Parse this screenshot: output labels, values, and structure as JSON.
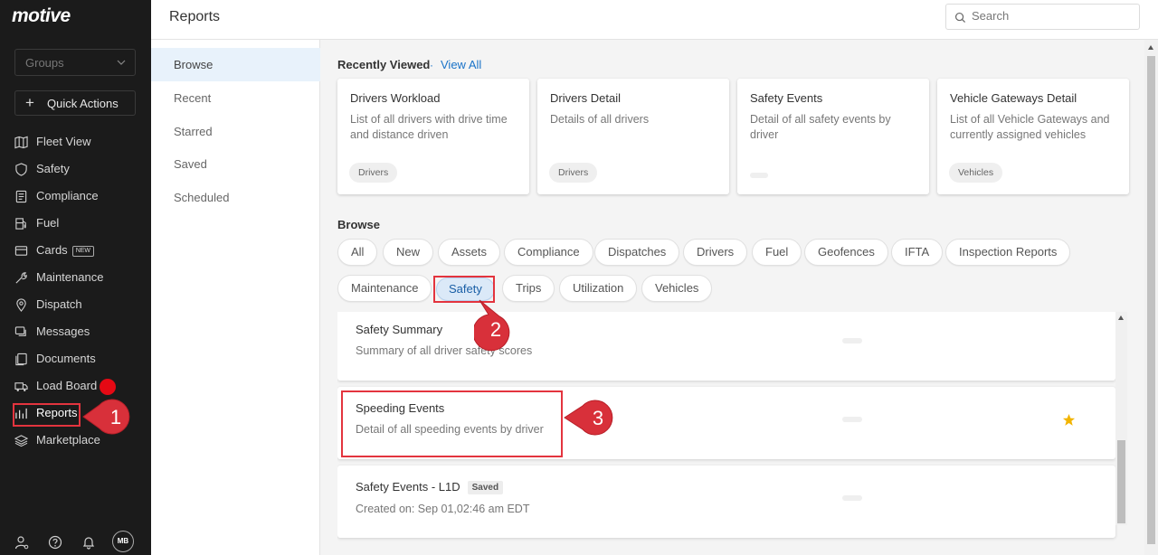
{
  "app": {
    "logo": "motive"
  },
  "sidebar": {
    "groups_placeholder": "Groups",
    "quick_actions": "Quick Actions",
    "items": [
      {
        "label": "Fleet View",
        "icon": "map-icon"
      },
      {
        "label": "Safety",
        "icon": "shield-icon"
      },
      {
        "label": "Compliance",
        "icon": "document-icon"
      },
      {
        "label": "Fuel",
        "icon": "fuel-pump-icon"
      },
      {
        "label": "Cards",
        "icon": "card-icon",
        "badge": "NEW"
      },
      {
        "label": "Maintenance",
        "icon": "wrench-icon"
      },
      {
        "label": "Dispatch",
        "icon": "location-pin-icon"
      },
      {
        "label": "Messages",
        "icon": "messages-icon"
      },
      {
        "label": "Documents",
        "icon": "documents-icon"
      },
      {
        "label": "Load Board",
        "icon": "truck-icon"
      },
      {
        "label": "Reports",
        "icon": "bar-chart-icon"
      },
      {
        "label": "Marketplace",
        "icon": "layers-icon"
      }
    ],
    "avatar_initials": "MB"
  },
  "header": {
    "title": "Reports",
    "search_placeholder": "Search"
  },
  "subnav": {
    "items": [
      "Browse",
      "Recent",
      "Starred",
      "Saved",
      "Scheduled"
    ],
    "active": "Browse"
  },
  "recently_viewed": {
    "title": "Recently Viewed",
    "separator": "·",
    "view_all": "View All",
    "cards": [
      {
        "title": "Drivers Workload",
        "desc": "List of all drivers with drive time and distance driven",
        "tag": "Drivers"
      },
      {
        "title": "Drivers Detail",
        "desc": "Details of all drivers",
        "tag": "Drivers"
      },
      {
        "title": "Safety Events",
        "desc": "Detail of all safety events by driver",
        "tag": ""
      },
      {
        "title": "Vehicle Gateways Detail",
        "desc": "List of all Vehicle Gateways and currently assigned vehicles",
        "tag": "Vehicles"
      }
    ]
  },
  "browse": {
    "title": "Browse",
    "chips": [
      "All",
      "New",
      "Assets",
      "Compliance",
      "Dispatches",
      "Drivers",
      "Fuel",
      "Geofences",
      "IFTA",
      "Inspection Reports",
      "Maintenance",
      "Safety",
      "Trips",
      "Utilization",
      "Vehicles"
    ],
    "active_chip": "Safety"
  },
  "reports": [
    {
      "title": "Safety Summary",
      "desc": "Summary of all driver safety scores",
      "starred": false,
      "saved_badge": ""
    },
    {
      "title": "Speeding Events",
      "desc": "Detail of all speeding events by driver",
      "starred": true,
      "saved_badge": ""
    },
    {
      "title": "Safety Events - L1D",
      "desc": "Created on: Sep 01,02:46 am EDT",
      "starred": false,
      "saved_badge": "Saved"
    }
  ],
  "callouts": [
    "1",
    "2",
    "3"
  ],
  "colors": {
    "sidebar_bg": "#1b1b1b",
    "accent_blue": "#1a73c8",
    "callout_red": "#e3343e",
    "star": "#f2b400",
    "load_board_dot": "#e50914"
  }
}
